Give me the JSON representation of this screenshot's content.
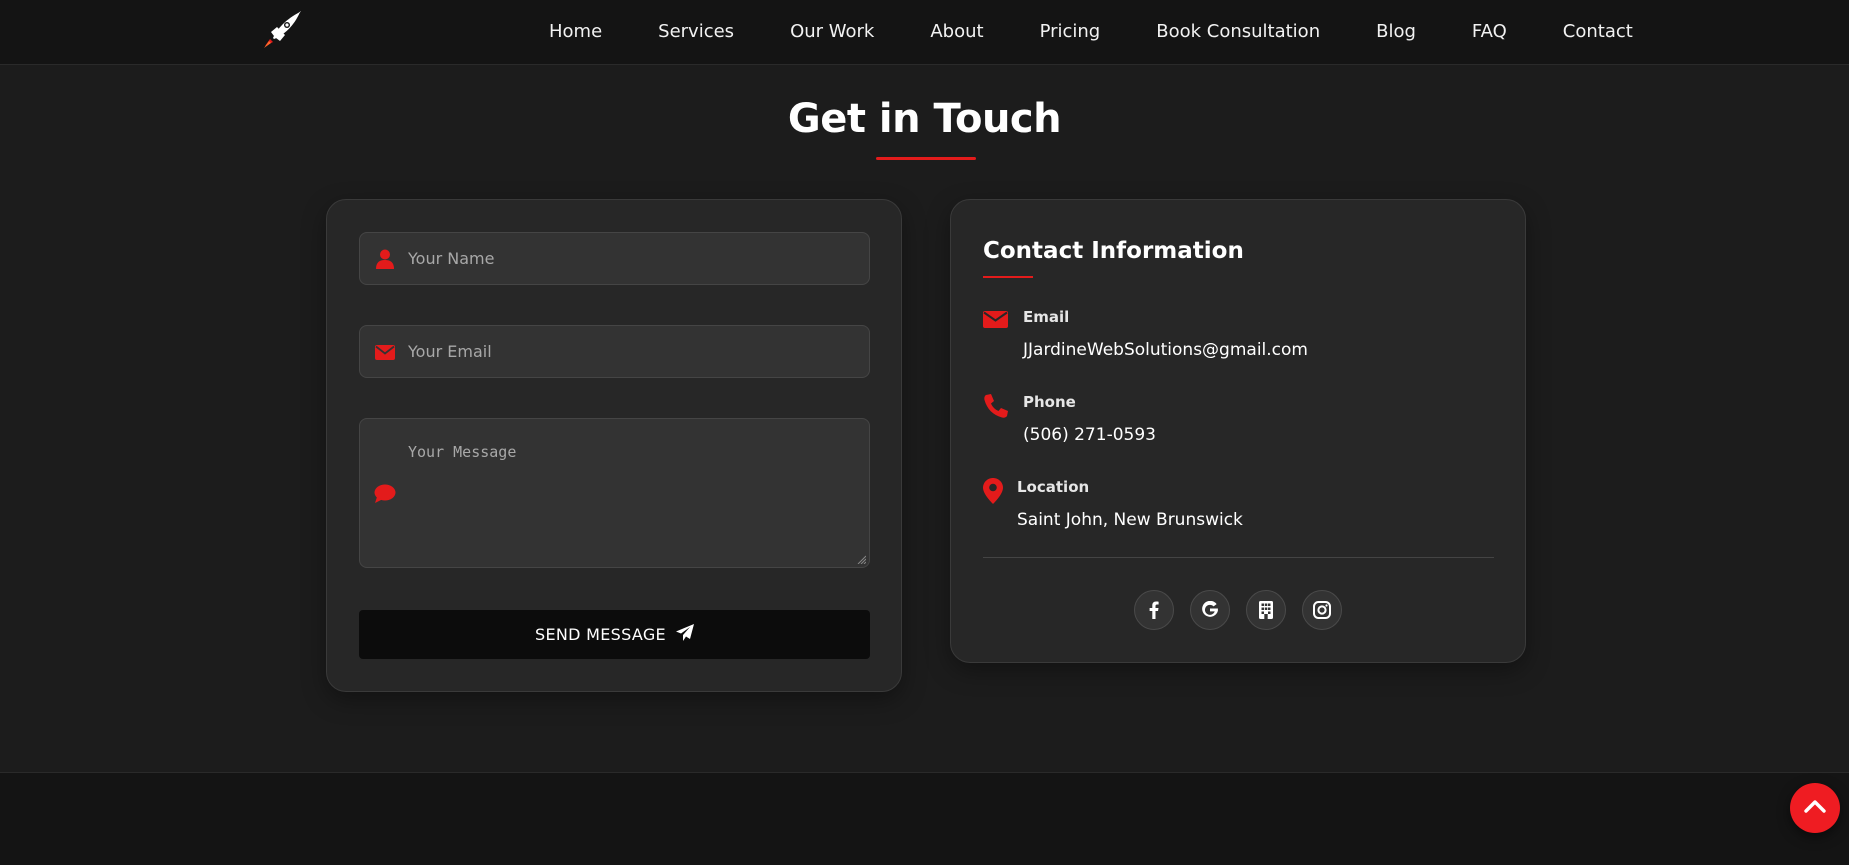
{
  "nav": {
    "logo_icon": "rocket-icon",
    "links": [
      "Home",
      "Services",
      "Our Work",
      "About",
      "Pricing",
      "Book Consultation",
      "Blog",
      "FAQ",
      "Contact"
    ]
  },
  "section": {
    "title": "Get in Touch"
  },
  "form": {
    "name_placeholder": "Your Name",
    "email_placeholder": "Your Email",
    "message_placeholder": "Your Message",
    "send_label": "SEND MESSAGE",
    "icons": [
      "user-icon",
      "envelope-icon",
      "comment-icon",
      "paper-plane-icon"
    ]
  },
  "contact_info": {
    "title": "Contact Information",
    "email_label": "Email",
    "email_value": "JJardineWebSolutions@gmail.com",
    "phone_label": "Phone",
    "phone_value": "(506) 271-0593",
    "location_label": "Location",
    "location_value": "Saint John, New Brunswick",
    "socials": [
      "facebook-icon",
      "google-icon",
      "building-icon",
      "instagram-icon"
    ]
  },
  "colors": {
    "accent": "#e31b1b",
    "background": "#1c1c1c",
    "card": "#272727",
    "navbar": "#141414"
  },
  "back_to_top_icon": "chevron-up-icon"
}
